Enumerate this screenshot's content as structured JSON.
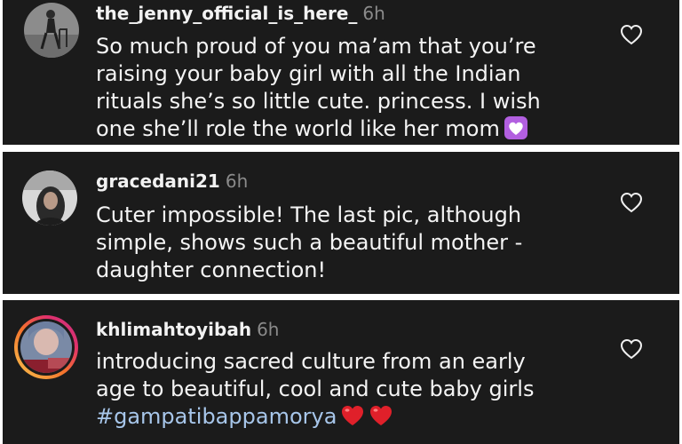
{
  "comments": [
    {
      "username": "the_jenny_official_is_here_",
      "time": "6h",
      "lines": [
        "So much proud of you ma’am that you’re",
        "raising your baby girl with all the Indian",
        "rituals she’s so little cute. princess.  I wish",
        "one she’ll role the world like her mom"
      ],
      "emoji": "purple-heart"
    },
    {
      "username": "gracedani21",
      "time": "6h",
      "lines": [
        "Cuter impossible!  The last pic, although",
        "simple, shows such a beautiful mother -",
        "daughter connection!"
      ]
    },
    {
      "username": "khlimahtoyibah",
      "time": "6h",
      "lines": [
        "introducing sacred culture from an early",
        "age to beautiful, cool and cute baby girls"
      ],
      "hashtag": "#gampatibappamorya",
      "emoji": "red-heart"
    }
  ],
  "icons": {
    "like": "heart-outline-icon",
    "story_ring": "story-ring-gradient"
  },
  "colors": {
    "background": "#1b1b1b",
    "text": "#f4f4f4",
    "meta": "#8a8a8a",
    "hashtag": "#a7c6ea",
    "heart_emoji": "#e0202a",
    "purple_heart_emoji": "#b25fe0"
  }
}
